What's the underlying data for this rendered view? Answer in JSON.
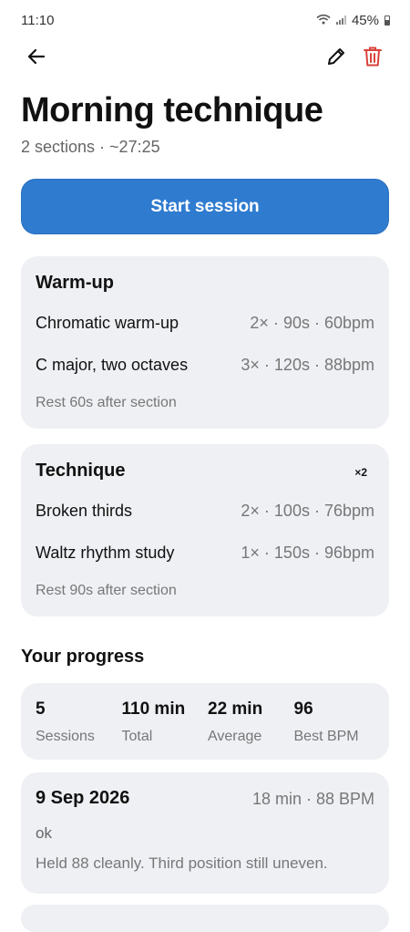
{
  "status_bar": {
    "time": "11:10",
    "battery": "45%"
  },
  "header": {
    "title": "Morning technique",
    "subtitle": "2 sections · ~27:25"
  },
  "actions": {
    "start_label": "Start session"
  },
  "sections": [
    {
      "title": "Warm-up",
      "badge": "",
      "exercises": [
        {
          "name": "Chromatic warm-up",
          "meta": "2× · 90s · 60bpm"
        },
        {
          "name": "C major, two octaves",
          "meta": "3× · 120s · 88bpm"
        }
      ],
      "rest": "Rest 60s after section"
    },
    {
      "title": "Technique",
      "badge": "×2",
      "exercises": [
        {
          "name": "Broken thirds",
          "meta": "2× · 100s · 76bpm"
        },
        {
          "name": "Waltz rhythm study",
          "meta": "1× · 150s · 96bpm"
        }
      ],
      "rest": "Rest 90s after section"
    }
  ],
  "progress": {
    "heading": "Your progress",
    "stats": [
      {
        "value": "5",
        "label": "Sessions"
      },
      {
        "value": "110 min",
        "label": "Total"
      },
      {
        "value": "22 min",
        "label": "Average"
      },
      {
        "value": "96",
        "label": "Best BPM"
      }
    ],
    "entries": [
      {
        "date": "9 Sep 2026",
        "meta": "18 min · 88 BPM",
        "rating": "ok",
        "note": "Held 88 cleanly. Third position still uneven."
      }
    ]
  },
  "colors": {
    "primary": "#2f7bd0",
    "card": "#eff0f4",
    "delete": "#d9423b"
  },
  "icons": {
    "back": "arrow-left-icon",
    "edit": "pencil-icon",
    "delete": "trash-icon"
  }
}
